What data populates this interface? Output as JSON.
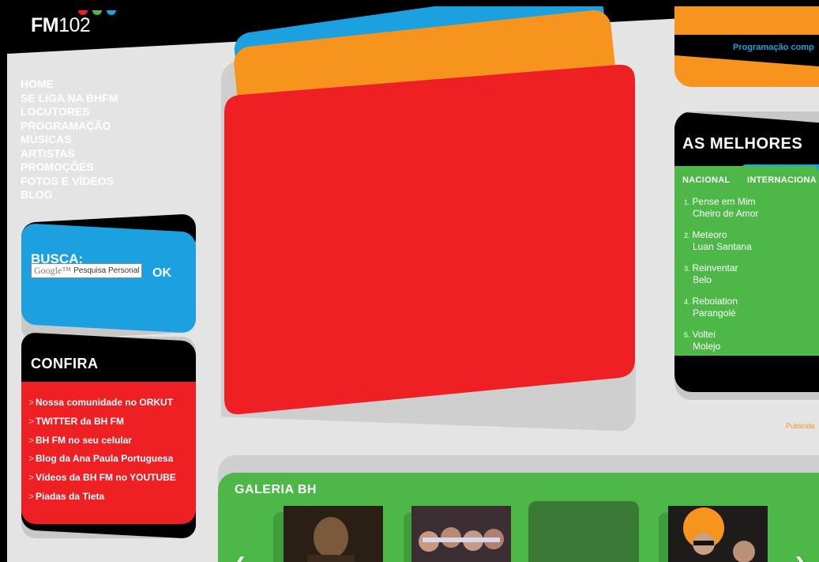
{
  "header": {
    "logo_bold": "FM",
    "logo_number": "102",
    "logo_colors": [
      "#ee2024",
      "#4db848",
      "#1ba1e0",
      "#f7941d"
    ]
  },
  "nav": {
    "items": [
      "HOME",
      "SE LIGA NA BHFM",
      "LOCUTORES",
      "PROGRAMAÇÃO",
      "MÚSICAS",
      "ARTISTAS",
      "PROMOÇÕES",
      "FOTOS E VÍDEOS",
      "BLOG"
    ]
  },
  "busca": {
    "title": "BUSCA:",
    "input_brand": "Google™",
    "placeholder": "Pesquisa Personal",
    "ok_label": "OK"
  },
  "confira": {
    "title": "CONFIRA",
    "links": [
      "Nossa comunidade no ORKUT",
      "TWITTER da BH FM",
      "BH FM no seu celular",
      "Blog da Ana Paula Portuguesa",
      "Vídeos da BH FM no YOUTUBE",
      "Piadas da Tieta"
    ]
  },
  "programacao": {
    "link": "Programação comp"
  },
  "melhores": {
    "title": "AS MELHORES",
    "tab_nacional": "NACIONAL",
    "tab_internacional": "INTERNACIONA",
    "ranking": [
      {
        "num": "1.",
        "song": "Pense em Mim",
        "artist": "Cheiro de Amor"
      },
      {
        "num": "2.",
        "song": "Meteoro",
        "artist": "Luan Santana"
      },
      {
        "num": "3.",
        "song": "Reinventar",
        "artist": "Belo"
      },
      {
        "num": "4.",
        "song": "Rebolation",
        "artist": "Parangolé"
      },
      {
        "num": "5.",
        "song": "Voltei",
        "artist": "Molejo"
      }
    ]
  },
  "publicidade": "Publicida",
  "galeria": {
    "title": "GALERIA BH",
    "prev_arrow": "‹",
    "next_arrow": "›"
  },
  "colors": {
    "red": "#ee2024",
    "green": "#4db848",
    "blue": "#1ba1e0",
    "orange": "#f7941d",
    "page_bg": "#e4e4e4"
  }
}
